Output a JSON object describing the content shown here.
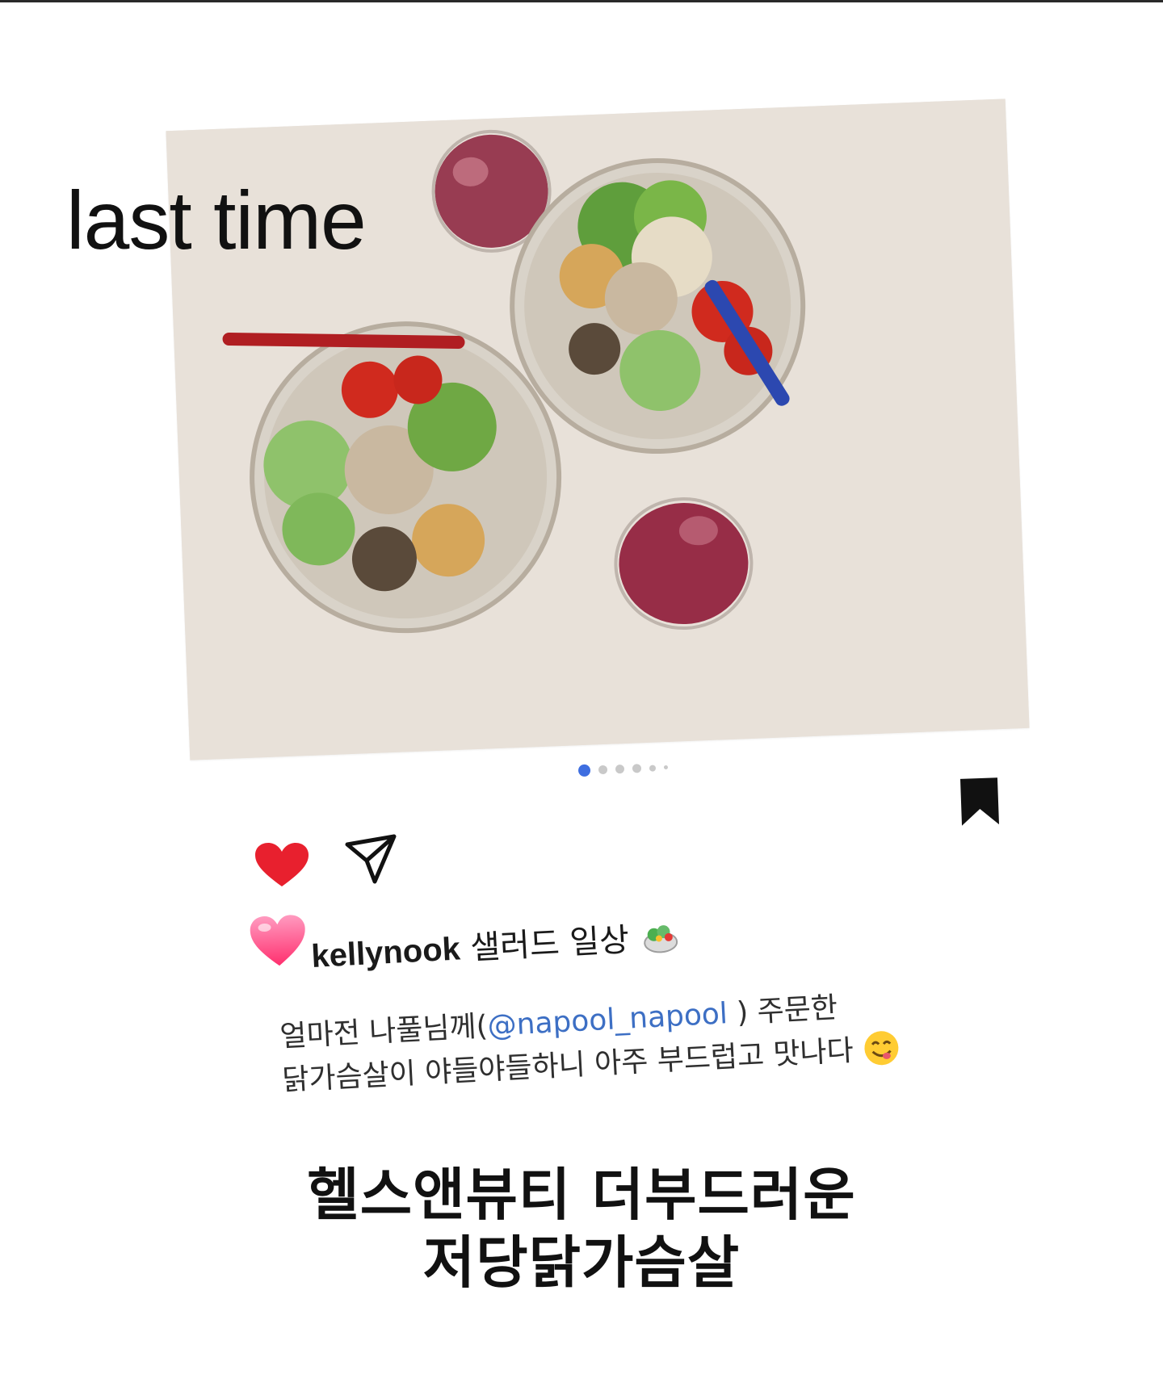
{
  "overlay": {
    "title": "last time"
  },
  "photo": {
    "description_icon": "salad-bowls-photo"
  },
  "carousel": {
    "count": 6,
    "active_index": 0,
    "active_color": "#3e6ee0"
  },
  "actions": {
    "like_icon": "heart-icon",
    "share_icon": "send-icon",
    "bookmark_icon": "bookmark-icon",
    "like_color": "#e8202e"
  },
  "post": {
    "username": "kellynook",
    "title": "샐러드 일상",
    "caption_pre": "얼마전 나풀님께(",
    "mention": "@napool_napool",
    "caption_post": " ) 주문한",
    "caption_line2": "닭가슴살이 야들야들하니 아주 부드럽고 맛나다",
    "mention_color": "#3d6fc4"
  },
  "promo": {
    "line1": "헬스앤뷰티 더부드러운",
    "line2": "저당닭가슴살"
  }
}
